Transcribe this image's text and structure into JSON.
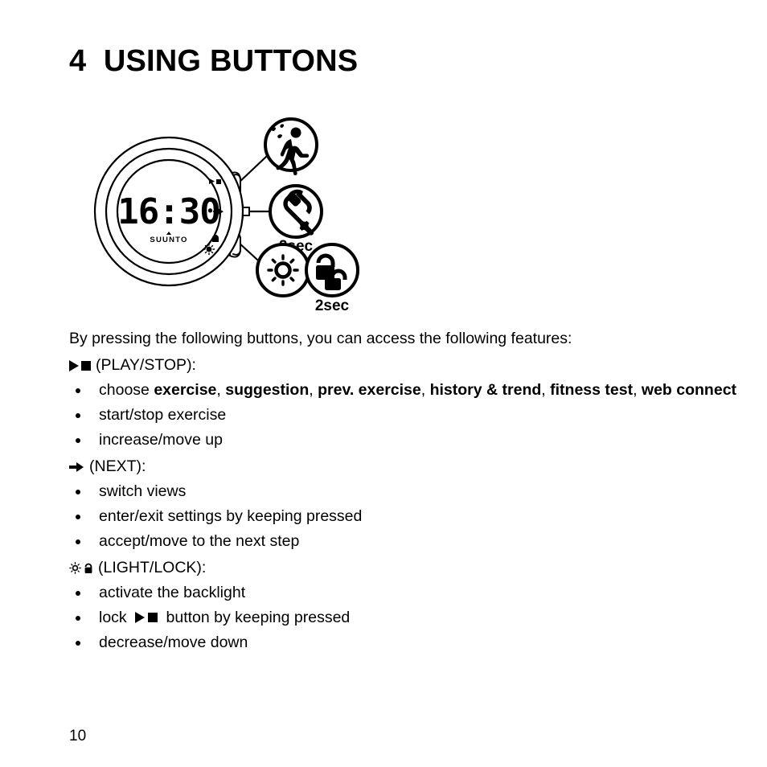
{
  "document": {
    "title": "4  USING BUTTONS",
    "page_number": "10"
  },
  "figure": {
    "name": "suunto-watch-buttons-diagram",
    "watch": {
      "brand": "SUUNTO",
      "display_time": "16:30"
    },
    "callouts": [
      {
        "icon": "runner-icon",
        "label": ""
      },
      {
        "icon": "wrench-icon",
        "label": "2sec"
      },
      {
        "icon": "sun-icon",
        "label": ""
      },
      {
        "icon": "lock-icon",
        "label": "2sec"
      }
    ]
  },
  "content": {
    "intro": "By pressing the following buttons, you can access the following features:",
    "groups": [
      {
        "id": "play-stop",
        "glyphs": [
          "play-icon",
          "stop-icon"
        ],
        "heading": "(PLAY/STOP):",
        "items": [
          {
            "type": "rich",
            "parts": [
              {
                "text": "choose ",
                "bold": false
              },
              {
                "text": "exercise",
                "bold": true
              },
              {
                "text": ", ",
                "bold": false
              },
              {
                "text": "suggestion",
                "bold": true
              },
              {
                "text": ", ",
                "bold": false
              },
              {
                "text": "prev. exercise",
                "bold": true
              },
              {
                "text": ", ",
                "bold": false
              },
              {
                "text": "history & trend",
                "bold": true
              },
              {
                "text": ", ",
                "bold": false
              },
              {
                "text": "fitness test",
                "bold": true
              },
              {
                "text": ", ",
                "bold": false
              },
              {
                "text": "web connect",
                "bold": true
              }
            ]
          },
          {
            "type": "text",
            "text": "start/stop exercise"
          },
          {
            "type": "text",
            "text": "increase/move up"
          }
        ]
      },
      {
        "id": "next",
        "glyphs": [
          "arrow-right-icon"
        ],
        "heading": "(NEXT):",
        "items": [
          {
            "type": "text",
            "text": "switch views"
          },
          {
            "type": "text",
            "text": "enter/exit settings by keeping pressed"
          },
          {
            "type": "text",
            "text": "accept/move to the next step"
          }
        ]
      },
      {
        "id": "light-lock",
        "glyphs": [
          "sun-icon",
          "lock-icon"
        ],
        "heading": "(LIGHT/LOCK):",
        "items": [
          {
            "type": "text",
            "text": "activate the backlight"
          },
          {
            "type": "rich",
            "parts": [
              {
                "text": "lock ",
                "bold": false
              },
              {
                "text": "[PLAYSTOP]",
                "bold": false
              },
              {
                "text": " button by keeping pressed",
                "bold": false
              }
            ]
          },
          {
            "type": "text",
            "text": "decrease/move down"
          }
        ]
      }
    ]
  },
  "colors": {
    "ink": "#000000",
    "paper": "#ffffff"
  }
}
